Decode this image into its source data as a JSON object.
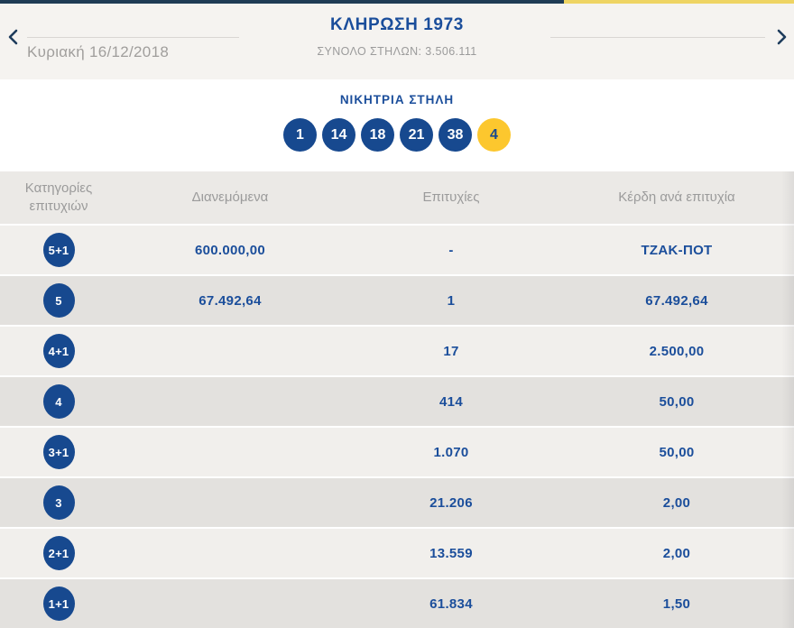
{
  "header": {
    "title": "ΚΛΗΡΩΣΗ 1973",
    "subtitle": "ΣΥΝΟΛΟ ΣΤΗΛΩΝ: 3.506.111",
    "date": "Κυριακή 16/12/2018",
    "prev_icon": "chevron-left-icon",
    "next_icon": "chevron-right-icon"
  },
  "winning_column": {
    "heading": "ΝΙΚΗΤΡΙΑ ΣΤΗΛΗ",
    "numbers": [
      "1",
      "14",
      "18",
      "21",
      "38"
    ],
    "bonus_number": "4"
  },
  "results_table": {
    "headers": [
      "Κατηγορίες επιτυχιών",
      "Διανεμόμενα",
      "Επιτυχίες",
      "Κέρδη ανά επιτυχία"
    ],
    "rows": [
      {
        "category": "5+1",
        "distributed": "600.000,00",
        "winners": "-",
        "prize_per_win": "ΤΖΑΚ-ΠΟΤ"
      },
      {
        "category": "5",
        "distributed": "67.492,64",
        "winners": "1",
        "prize_per_win": "67.492,64"
      },
      {
        "category": "4+1",
        "distributed": "",
        "winners": "17",
        "prize_per_win": "2.500,00"
      },
      {
        "category": "4",
        "distributed": "",
        "winners": "414",
        "prize_per_win": "50,00"
      },
      {
        "category": "3+1",
        "distributed": "",
        "winners": "1.070",
        "prize_per_win": "50,00"
      },
      {
        "category": "3",
        "distributed": "",
        "winners": "21.206",
        "prize_per_win": "2,00"
      },
      {
        "category": "2+1",
        "distributed": "",
        "winners": "13.559",
        "prize_per_win": "2,00"
      },
      {
        "category": "1+1",
        "distributed": "",
        "winners": "61.834",
        "prize_per_win": "1,50"
      }
    ]
  },
  "colors": {
    "navy": "#17498f",
    "navy_text": "#1b4e9b",
    "bonus_yellow": "#fcc72e",
    "topbar_navy": "#1f3c55",
    "topbar_yellow": "#eed463",
    "gray_text": "#9b9b9b",
    "header_bg": "#f5f3f0",
    "table_header_bg": "#ebe9e6",
    "row_light": "#f1efec",
    "row_dark": "#e3e1de"
  }
}
